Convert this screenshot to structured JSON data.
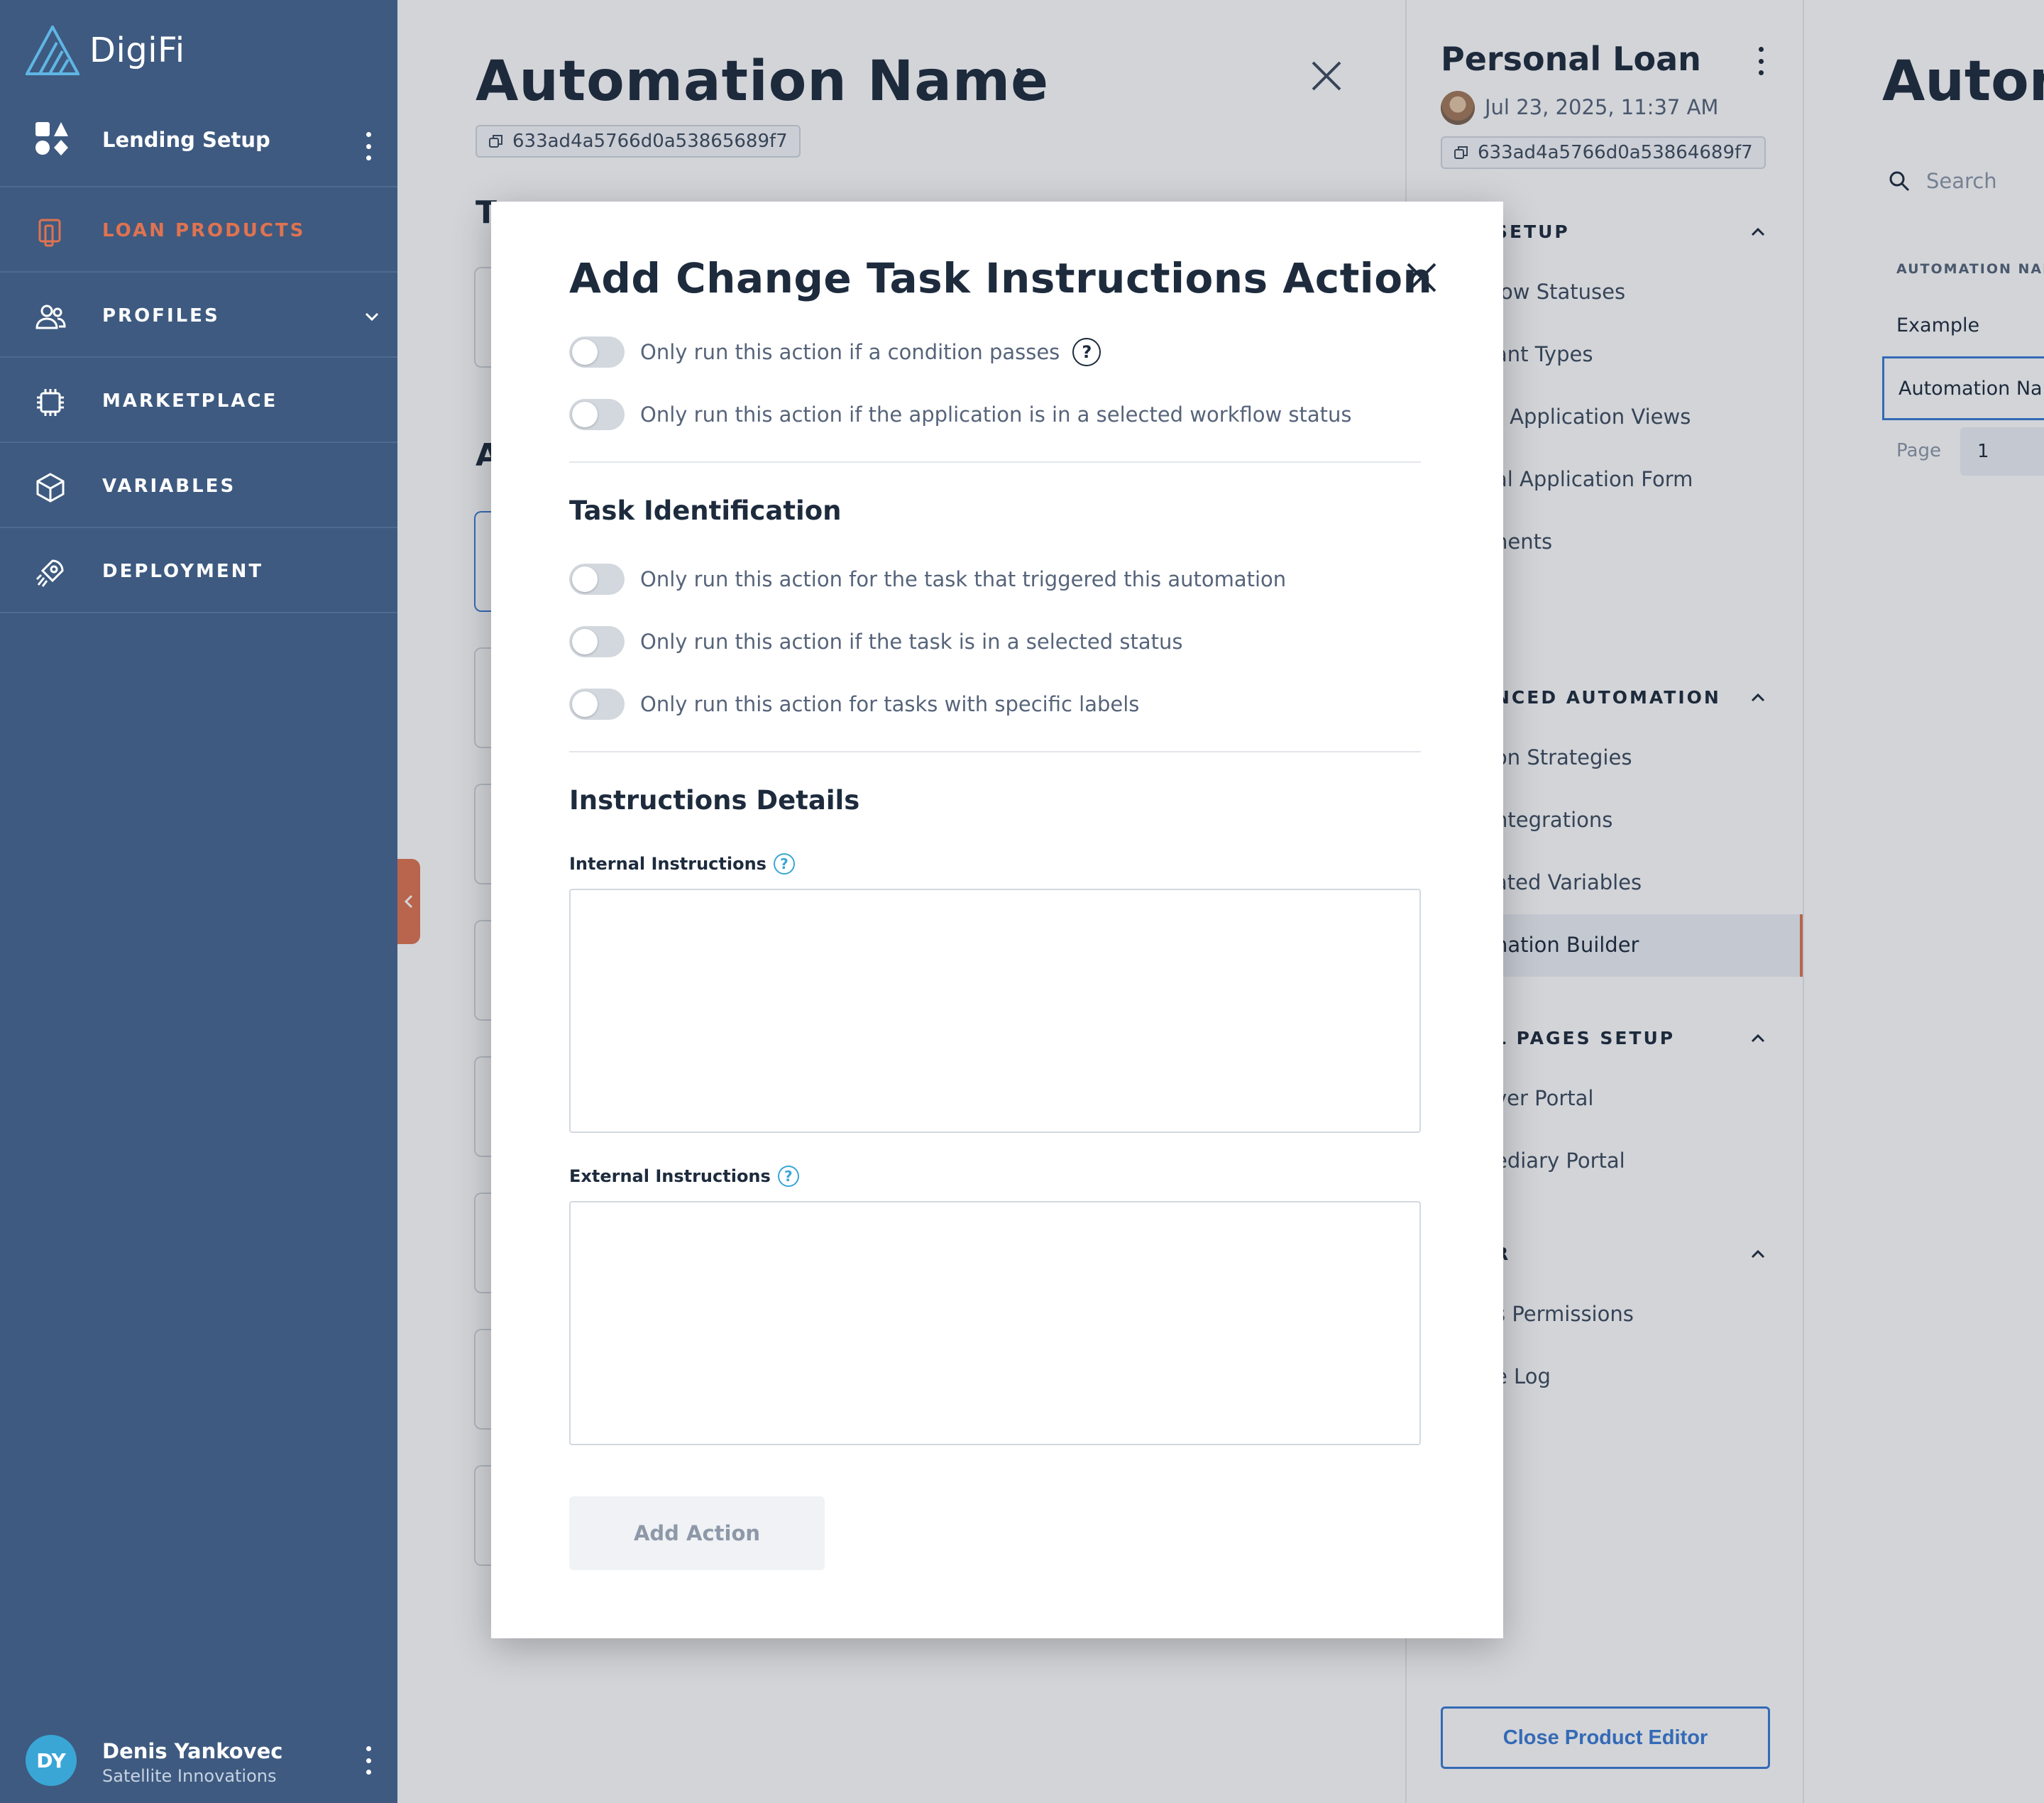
{
  "app": {
    "logo_text": "DigiFi"
  },
  "sidebar": {
    "setup_label": "Lending Setup",
    "items": [
      {
        "label": "LOAN PRODUCTS",
        "icon": "loan-products-icon",
        "active": true
      },
      {
        "label": "PROFILES",
        "icon": "profiles-icon",
        "has_chevron": true
      },
      {
        "label": "MARKETPLACE",
        "icon": "marketplace-icon"
      },
      {
        "label": "VARIABLES",
        "icon": "variables-icon"
      },
      {
        "label": "DEPLOYMENT",
        "icon": "deployment-icon"
      }
    ],
    "user": {
      "initials": "DY",
      "name": "Denis Yankovec",
      "org": "Satellite Innovations"
    }
  },
  "background_panel": {
    "title": "Automation Name",
    "id": "633ad4a5766d0a53865689f7",
    "fragments": {
      "t": "T",
      "a": "A"
    }
  },
  "product_panel": {
    "title": "Personal Loan",
    "date": "Jul 23, 2025, 11:37 AM",
    "id": "633ad4a5766d0a53864689f7",
    "sections": [
      {
        "heading": "SETUP",
        "items": [
          "low Statuses",
          "ant Types",
          "r Application Views",
          "al Application Form",
          "nents"
        ]
      },
      {
        "heading": "NCED AUTOMATION",
        "items": [
          "on Strategies",
          "ntegrations",
          "ated Variables",
          "nation Builder"
        ]
      },
      {
        "heading": "L PAGES SETUP",
        "items": [
          "ver Portal",
          "ediary Portal"
        ]
      },
      {
        "heading": "R",
        "items": [
          "s Permissions",
          "e Log"
        ]
      }
    ],
    "close_button": "Close Product Editor"
  },
  "list_panel": {
    "title": "Autom",
    "search_placeholder": "Search",
    "column_header": "AUTOMATION NAM",
    "rows": [
      "Example",
      "Automation Nam"
    ],
    "page_label": "Page",
    "page_value": "1"
  },
  "modal": {
    "title": "Add Change Task Instructions Action",
    "conditions": [
      {
        "label": "Only run this action if a condition passes",
        "help": "?",
        "on": false
      },
      {
        "label": "Only run this action if the application is in a selected workflow status",
        "on": false
      }
    ],
    "task_identification": {
      "title": "Task Identification",
      "toggles": [
        {
          "label": "Only run this action for the task that triggered this automation",
          "on": false
        },
        {
          "label": "Only run this action if the task is in a selected status",
          "on": false
        },
        {
          "label": "Only run this action for tasks with specific labels",
          "on": false
        }
      ]
    },
    "instructions": {
      "title": "Instructions Details",
      "internal_label": "Internal Instructions",
      "internal_value": "",
      "external_label": "External Instructions",
      "external_value": "",
      "help": "?"
    },
    "submit_label": "Add Action"
  },
  "colors": {
    "sidebar_bg": "#3e5a80",
    "accent_orange": "#e07350",
    "accent_blue": "#3a7bd5",
    "help_blue": "#3aa6d6",
    "text_dark": "#1d2b3d"
  }
}
